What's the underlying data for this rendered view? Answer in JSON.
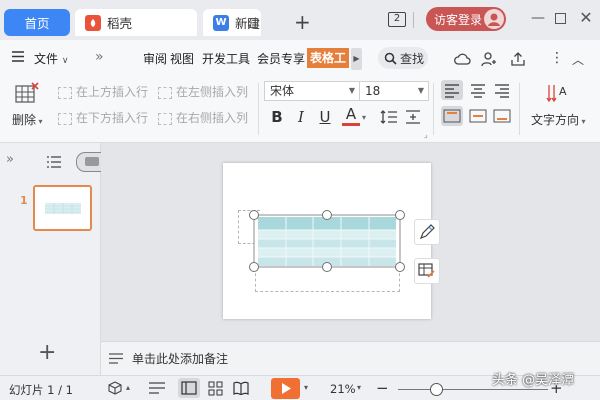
{
  "tabs": {
    "home": "首页",
    "daoke": "稻壳",
    "new_doc": "新建"
  },
  "window": {
    "screen_count": "2",
    "login_label": "访客登录"
  },
  "menu": {
    "file_label": "文件",
    "tabs": [
      "审阅",
      "视图",
      "开发工具",
      "会员专享"
    ],
    "table_tool": "表格工具",
    "search_label": "查找"
  },
  "ribbon": {
    "delete_label": "删除",
    "insert_above": "在上方插入行",
    "insert_below": "在下方插入行",
    "insert_left": "在左侧插入列",
    "insert_right": "在右侧插入列",
    "font_name": "宋体",
    "font_size": "18",
    "text_direction": "文字方向"
  },
  "sidebar": {
    "slide_number": "1"
  },
  "notes": {
    "placeholder": "单击此处添加备注"
  },
  "status": {
    "slide_info": "幻灯片 1 / 1",
    "zoom": "21%",
    "zoom_fraction": 0.25
  },
  "watermark": "头条 @吴泽潭",
  "colors": {
    "accent_blue": "#3d86f5",
    "table_tool_orange": "#e67e3c",
    "login_red": "#c95555",
    "play_orange": "#f07034",
    "table_cyan": "#a8d8dc"
  }
}
